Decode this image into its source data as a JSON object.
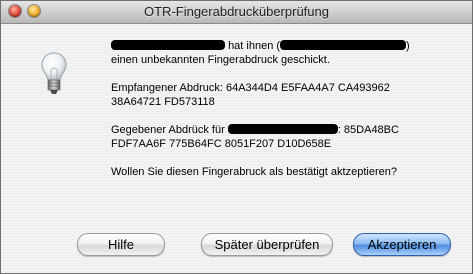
{
  "window": {
    "title": "OTR-Fingerabdrucküberprüfung"
  },
  "message": {
    "line1_suffix": "hat ihnen (",
    "line1_end": ")",
    "line2": "einen unbekannten Fingerabdruck geschickt.",
    "received_label": "Empfangener Abdruck:",
    "received_fp_1": "64A344D4 E5FAA4A7 CA493962",
    "received_fp_2": "38A64721 FD573118",
    "given_label": "Gegebener Abdrück für",
    "given_sep": ": 85DA48BC",
    "given_fp_2": "FDF7AA6F 775B64FC 8051F207 D10D658E",
    "question": "Wollen Sie diesen Fingerabruck als bestätigt aktzeptieren?"
  },
  "buttons": {
    "help": "Hilfe",
    "later": "Später überprüfen",
    "accept": "Akzeptieren"
  },
  "icons": {
    "window_close": "close-button",
    "window_minimize": "minimize-button",
    "dialog_icon": "lightbulb-icon"
  },
  "colors": {
    "redaction": "#000000",
    "default_button": "#4f8fe0"
  }
}
